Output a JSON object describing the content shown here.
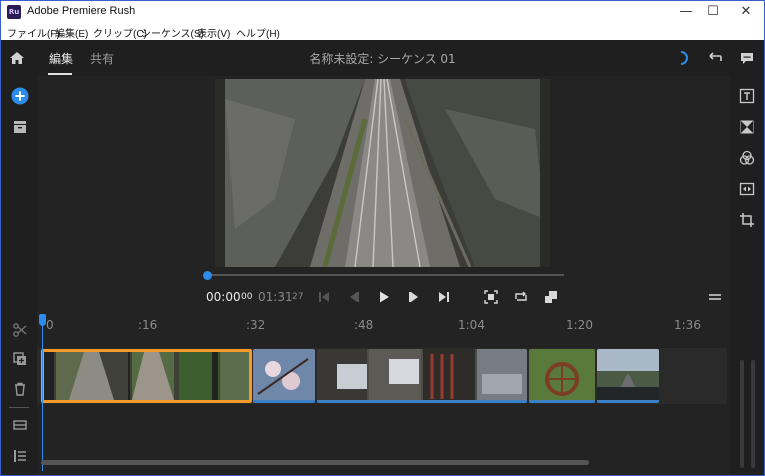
{
  "window": {
    "title": "Adobe Premiere Rush",
    "app_icon_text": "Ru",
    "controls": {
      "minimize": "—",
      "maximize": "☐",
      "close": "✕"
    }
  },
  "menu": [
    {
      "label": "ファイル(F)"
    },
    {
      "label": "編集(E)"
    },
    {
      "label": "クリップ(C)"
    },
    {
      "label": "シーケンス(S)"
    },
    {
      "label": "表示(V)"
    },
    {
      "label": "ヘルプ(H)"
    }
  ],
  "header": {
    "tabs": [
      {
        "label": "編集",
        "active": true
      },
      {
        "label": "共有",
        "active": false
      }
    ],
    "sequence_title": "名称未設定: シーケンス 01"
  },
  "player": {
    "current_time": "00:00",
    "current_frames": "00",
    "duration": "01:31",
    "duration_frames": "27",
    "progress": 0
  },
  "timeline": {
    "ruler_labels": [
      "0",
      ":16",
      ":32",
      ":48",
      "1:04",
      "1:20",
      "1:36"
    ]
  },
  "colors": {
    "accent": "#2d8ceb",
    "selection": "#f49b2a",
    "background": "#232323"
  }
}
